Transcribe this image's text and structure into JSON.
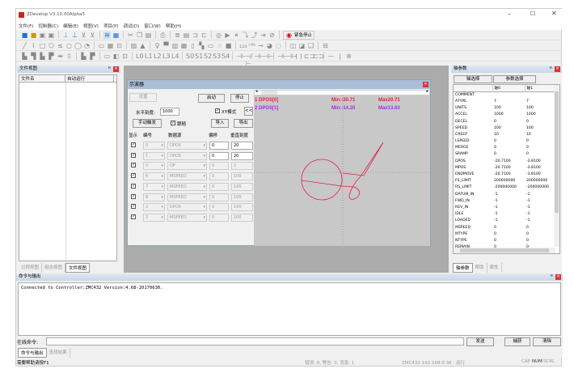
{
  "app": {
    "title": "ZDevelop V3.10.00Alpha5"
  },
  "menu": [
    "文件(F)",
    "控制器(C)",
    "编辑(E)",
    "视图(V)",
    "项目(P)",
    "调试(D)",
    "窗口(W)",
    "帮助(H)"
  ],
  "toolbar": {
    "emergency_stop": "紧急停止",
    "row3_labels": [
      "L0",
      "L1",
      "L2",
      "L3",
      "L4",
      "S0",
      "S1",
      "S2",
      "S3",
      "S4"
    ]
  },
  "file_view": {
    "title": "文件视图",
    "columns": [
      "文件名",
      "自动运行"
    ],
    "tabs": [
      "过程视图",
      "组态视图",
      "文件视图"
    ]
  },
  "scope": {
    "title": "示波器",
    "settings": "设置",
    "start": "启动",
    "stop": "停止",
    "h_scale_label": "水平刻度:",
    "h_scale": "1000",
    "xy_mode": "XY模式",
    "collapse": "<<",
    "manual_trigger": "手动触发",
    "follow": "跟随",
    "import": "导入",
    "export": "导出",
    "headers": [
      "显示",
      "编号",
      "数据源",
      "偏移",
      "垂直刻度"
    ],
    "rows": [
      {
        "num": "0",
        "src": "DPOS",
        "offset": "0",
        "scale": "20",
        "on": true
      },
      {
        "num": "1",
        "src": "DPOS",
        "offset": "0",
        "scale": "20",
        "on": true
      },
      {
        "num": "0",
        "src": "OP",
        "offset": "0",
        "scale": "2",
        "on": false
      },
      {
        "num": "6",
        "src": "MSPEED",
        "offset": "0",
        "scale": "100",
        "on": false
      },
      {
        "num": "7",
        "src": "MSPEED",
        "offset": "0",
        "scale": "100",
        "on": false
      },
      {
        "num": "8",
        "src": "MSPEED",
        "offset": "0",
        "scale": "100",
        "on": false
      },
      {
        "num": "2",
        "src": "DPOS",
        "offset": "0",
        "scale": "100",
        "on": false
      },
      {
        "num": "2",
        "src": "MSPEED",
        "offset": "0",
        "scale": "100",
        "on": false
      }
    ],
    "legend": [
      {
        "name": "1 DPOS[0]",
        "min": "Min:-20.71",
        "max": "Max20.71",
        "color": "#e0204a"
      },
      {
        "name": "2 DPOS[1]",
        "min": "Min:-14.20",
        "max": "Max13.63",
        "color": "#9b30e0"
      }
    ]
  },
  "axis_params": {
    "title": "轴参数",
    "axis_select": "轴选择",
    "param_select": "参数选择",
    "columns": [
      "",
      "轴0",
      "轴1"
    ],
    "rows": [
      [
        "COMMENT",
        "",
        ""
      ],
      [
        "ATYPE",
        "7",
        "7"
      ],
      [
        "UNITS",
        "100",
        "100"
      ],
      [
        "ACCEL",
        "1000",
        "1000"
      ],
      [
        "DECEL",
        "0",
        "0"
      ],
      [
        "SPEED",
        "100",
        "100"
      ],
      [
        "CREEP",
        "10",
        "10"
      ],
      [
        "LSPEED",
        "0",
        "0"
      ],
      [
        "MERGE",
        "0",
        "0"
      ],
      [
        "SRAMP",
        "0",
        "0"
      ],
      [
        "DPOS",
        "-20.7100",
        "-3.8100"
      ],
      [
        "MPOS",
        "-20.7100",
        "-3.8100"
      ],
      [
        "ENDMOVE",
        "-20.7100",
        "-3.8100"
      ],
      [
        "FS_LIMIT",
        "200000000",
        "200000000"
      ],
      [
        "RS_LIMIT",
        "-200000000",
        "-200000000"
      ],
      [
        "DATUM_IN",
        "-1",
        "-1"
      ],
      [
        "FWD_IN",
        "-1",
        "-1"
      ],
      [
        "REV_IN",
        "-1",
        "-1"
      ],
      [
        "IDLE",
        "-1",
        "-1"
      ],
      [
        "LOADED",
        "-1",
        "-1"
      ],
      [
        "MSPEED",
        "0",
        "0"
      ],
      [
        "MTYPE",
        "0",
        "0"
      ],
      [
        "NTYPE",
        "0",
        "0"
      ],
      [
        "REMAIN",
        "0",
        "0"
      ]
    ],
    "tabs": [
      "轴参数",
      "帮助",
      "属性"
    ]
  },
  "output": {
    "title": "命令与输出",
    "text": "Connected to Controller:ZMC432 Version:4.68-20170630.",
    "cmd_label": "在线命令:",
    "cmd_value": "",
    "send": "发送",
    "capture": "捕获",
    "clear": "清除",
    "tabs": [
      "命令与输出",
      "查找结果"
    ]
  },
  "status": {
    "help": "需要帮助请按F1",
    "counts": "错误: 0, 警告: 0, 消息: 1",
    "connection": "ZMC432:192.168.0.38 - 运行",
    "caps": [
      "CAP",
      "NUM",
      "SCRL"
    ]
  }
}
